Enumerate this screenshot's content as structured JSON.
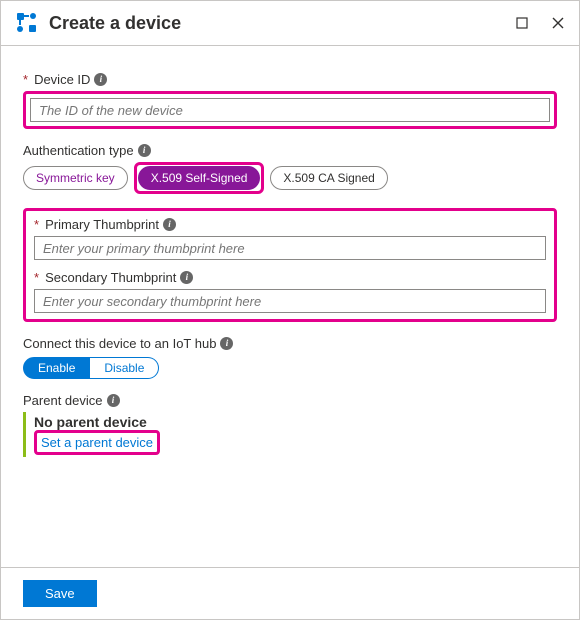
{
  "header": {
    "title": "Create a device"
  },
  "deviceId": {
    "label": "Device ID",
    "placeholder": "The ID of the new device"
  },
  "authType": {
    "label": "Authentication type",
    "options": {
      "symmetric": "Symmetric key",
      "selfSigned": "X.509 Self-Signed",
      "caSigned": "X.509 CA Signed"
    },
    "selected": "selfSigned"
  },
  "primaryThumb": {
    "label": "Primary Thumbprint",
    "placeholder": "Enter your primary thumbprint here"
  },
  "secondaryThumb": {
    "label": "Secondary Thumbprint",
    "placeholder": "Enter your secondary thumbprint here"
  },
  "connect": {
    "label": "Connect this device to an IoT hub",
    "enable": "Enable",
    "disable": "Disable",
    "value": "enable"
  },
  "parent": {
    "label": "Parent device",
    "none": "No parent device",
    "setLink": "Set a parent device"
  },
  "footer": {
    "save": "Save"
  }
}
